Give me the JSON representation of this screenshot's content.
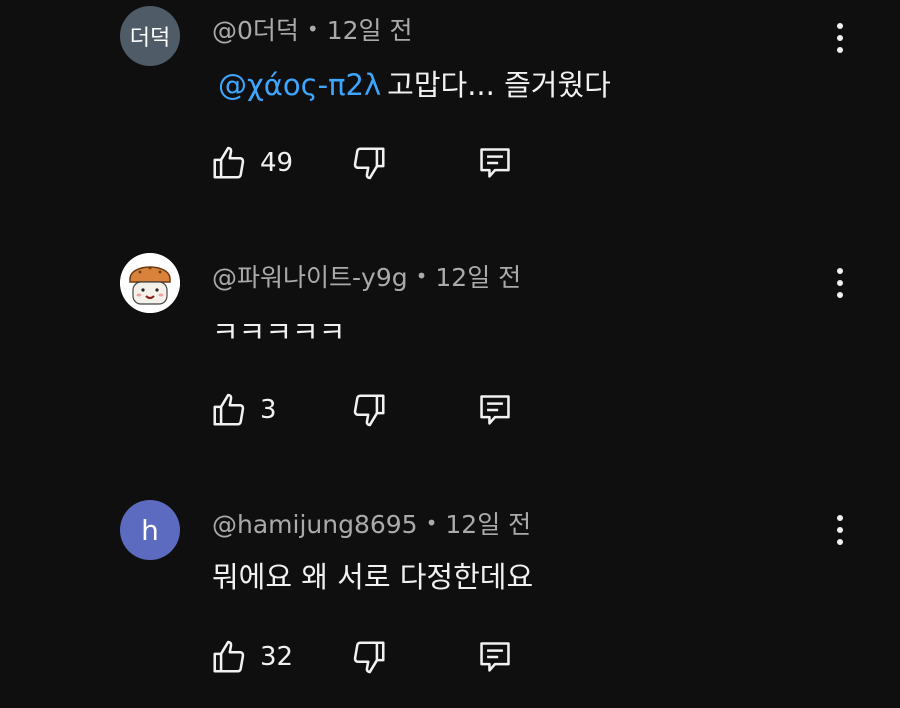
{
  "comments": [
    {
      "avatar_text": "더덕",
      "avatar_color": "#4f5b66",
      "author": "@0더덕",
      "dot": "•",
      "time": "12일 전",
      "mention": "@χάος-π2λ",
      "text": "고맙다... 즐거웠다",
      "likes": "49"
    },
    {
      "avatar_text": "",
      "avatar_color": "#ffffff",
      "author": "@파워나이트-y9g",
      "dot": "•",
      "time": "12일 전",
      "mention": "",
      "text": "ㅋㅋㅋㅋㅋ",
      "likes": "3"
    },
    {
      "avatar_text": "h",
      "avatar_color": "#5c6bc0",
      "author": "@hamijung8695",
      "dot": "•",
      "time": "12일 전",
      "mention": "",
      "text": "뭐에요 왜 서로 다정한데요",
      "likes": "32"
    }
  ],
  "icons": {
    "like": "thumb-up-icon",
    "dislike": "thumb-down-icon",
    "reply": "reply-icon",
    "menu": "more-vert-icon"
  },
  "colors": {
    "background": "#0f0f0f",
    "meta_text": "#aaaaaa",
    "mention": "#3ea6ff"
  }
}
